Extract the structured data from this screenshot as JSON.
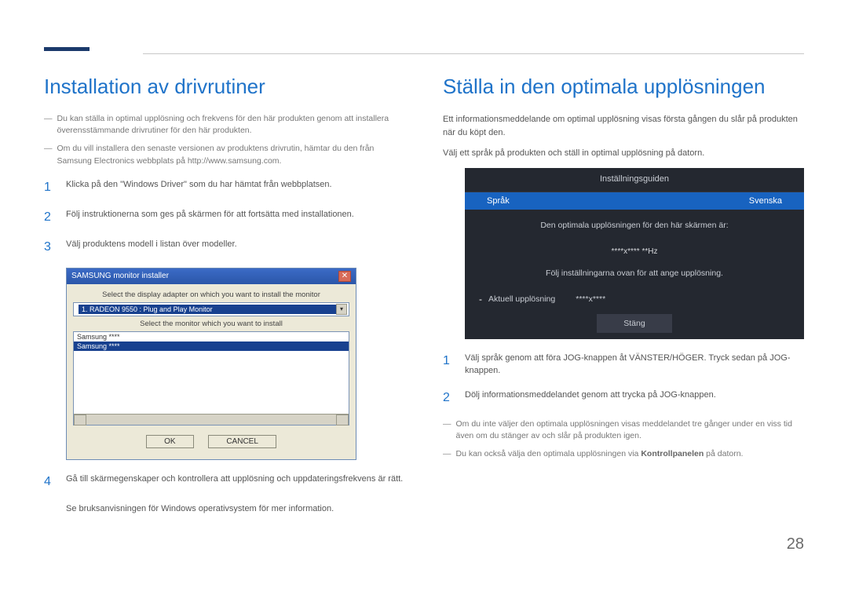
{
  "page_number": "28",
  "left": {
    "heading": "Installation av drivrutiner",
    "notes": [
      "Du kan ställa in optimal upplösning och frekvens för den här produkten genom att installera överensstämmande drivrutiner för den här produkten.",
      "Om du vill installera den senaste versionen av produktens drivrutin, hämtar du den från Samsung Electronics webbplats på http://www.samsung.com."
    ],
    "steps": [
      "Klicka på den \"Windows Driver\" som du har hämtat från webbplatsen.",
      "Följ instruktionerna som ges på skärmen för att fortsätta med installationen.",
      "Välj produktens modell i listan över modeller."
    ],
    "step4": "Gå till skärmegenskaper och kontrollera att upplösning och uppdateringsfrekvens är rätt.",
    "note_after": "Se bruksanvisningen för Windows operativsystem för mer information.",
    "dialog": {
      "title": "SAMSUNG monitor installer",
      "label1": "Select the display adapter on which you want to install the monitor",
      "select": "1. RADEON 9550 : Plug and Play Monitor",
      "label2": "Select the monitor which you want to install",
      "list_items": [
        "Samsung ****",
        "Samsung ****"
      ],
      "ok": "OK",
      "cancel": "CANCEL"
    }
  },
  "right": {
    "heading": "Ställa in den optimala upplösningen",
    "intro1": "Ett informationsmeddelande om optimal upplösning visas första gången du slår på produkten när du köpt den.",
    "intro2": "Välj ett språk på produkten och ställ in optimal upplösning på datorn.",
    "osd": {
      "title": "Inställningsguiden",
      "lang_label": "Språk",
      "lang_value": "Svenska",
      "optimal_text": "Den optimala upplösningen för den här skärmen är:",
      "resolution": "****x**** **Hz",
      "follow_text": "Följ inställningarna ovan för att ange upplösning.",
      "current_label": "Aktuell upplösning",
      "current_value": "****x****",
      "close": "Stäng"
    },
    "steps": [
      "Välj språk genom att föra JOG-knappen åt VÄNSTER/HÖGER. Tryck sedan på JOG-knappen.",
      "Dölj informationsmeddelandet genom att trycka på JOG-knappen."
    ],
    "notes": [
      "Om du inte väljer den optimala upplösningen visas meddelandet tre gånger under en viss tid även om du stänger av och slår på produkten igen."
    ],
    "note_kontroll_pre": "Du kan också välja den optimala upplösningen via ",
    "note_kontroll_bold": "Kontrollpanelen",
    "note_kontroll_post": " på datorn."
  }
}
